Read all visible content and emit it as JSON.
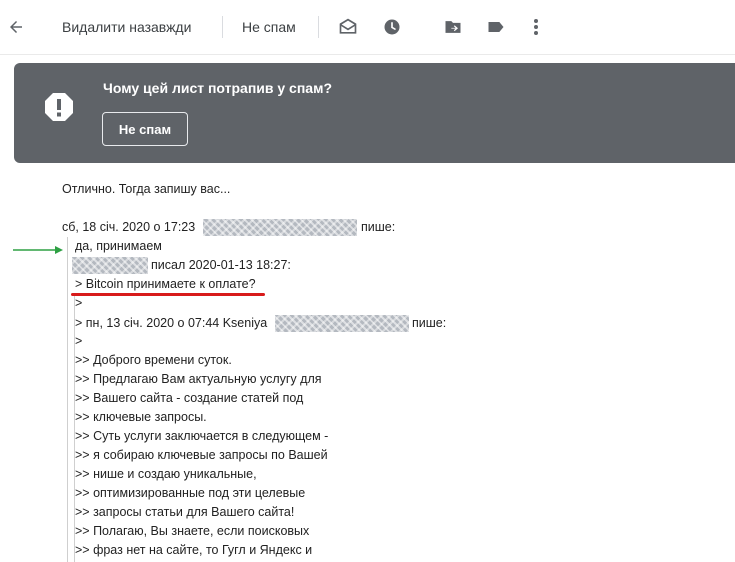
{
  "toolbar": {
    "back_icon": "arrow-back-icon",
    "delete_forever_label": "Видалити назавжди",
    "not_spam_label": "Не спам",
    "icons": [
      "mark-unread-icon",
      "snooze-clock-icon",
      "move-to-icon",
      "label-icon",
      "more-vert-icon"
    ]
  },
  "banner": {
    "icon": "warning-octagon-icon",
    "title": "Чому цей лист потрапив у спам?",
    "button_label": "Не спам",
    "bg_color": "#5f6368"
  },
  "message": {
    "greeting": "Отлично. Тогда запишу вас...",
    "reply_header_prefix": "сб, 18 січ. 2020 о 17:23",
    "reply_header_suffix": "пише:",
    "quote_line_accept": "да, принимаем",
    "quote_line_wrote": "писал 2020-01-13 18:27:",
    "quote_line_bitcoin": "> Bitcoin принимаете к оплате?",
    "quote_line_empty1": ">",
    "quote_line_kseniya_prefix": "> пн, 13 січ. 2020 о 07:44 Kseniya",
    "quote_line_kseniya_suffix": "пише:",
    "quote_line_empty2": ">",
    "body_lines": [
      ">> Доброго времени суток.",
      ">> Предлагаю Вам актуальную услугу для",
      ">> Вашего сайта - создание статей под",
      ">> ключевые запросы.",
      ">> Суть услуги заключается в следующем -",
      ">> я собираю ключевые запросы по Вашей",
      ">> нише и создаю уникальные,",
      ">> оптимизированные под эти целевые",
      ">> запросы статьи для Вашего сайта!",
      ">> Полагаю, Вы знаете, если поисковых",
      ">> фраз нет на сайте, то Гугл и Яндекс и"
    ]
  },
  "annotations": {
    "arrow_color": "#2ea043",
    "underline_color": "#d81b1b"
  }
}
